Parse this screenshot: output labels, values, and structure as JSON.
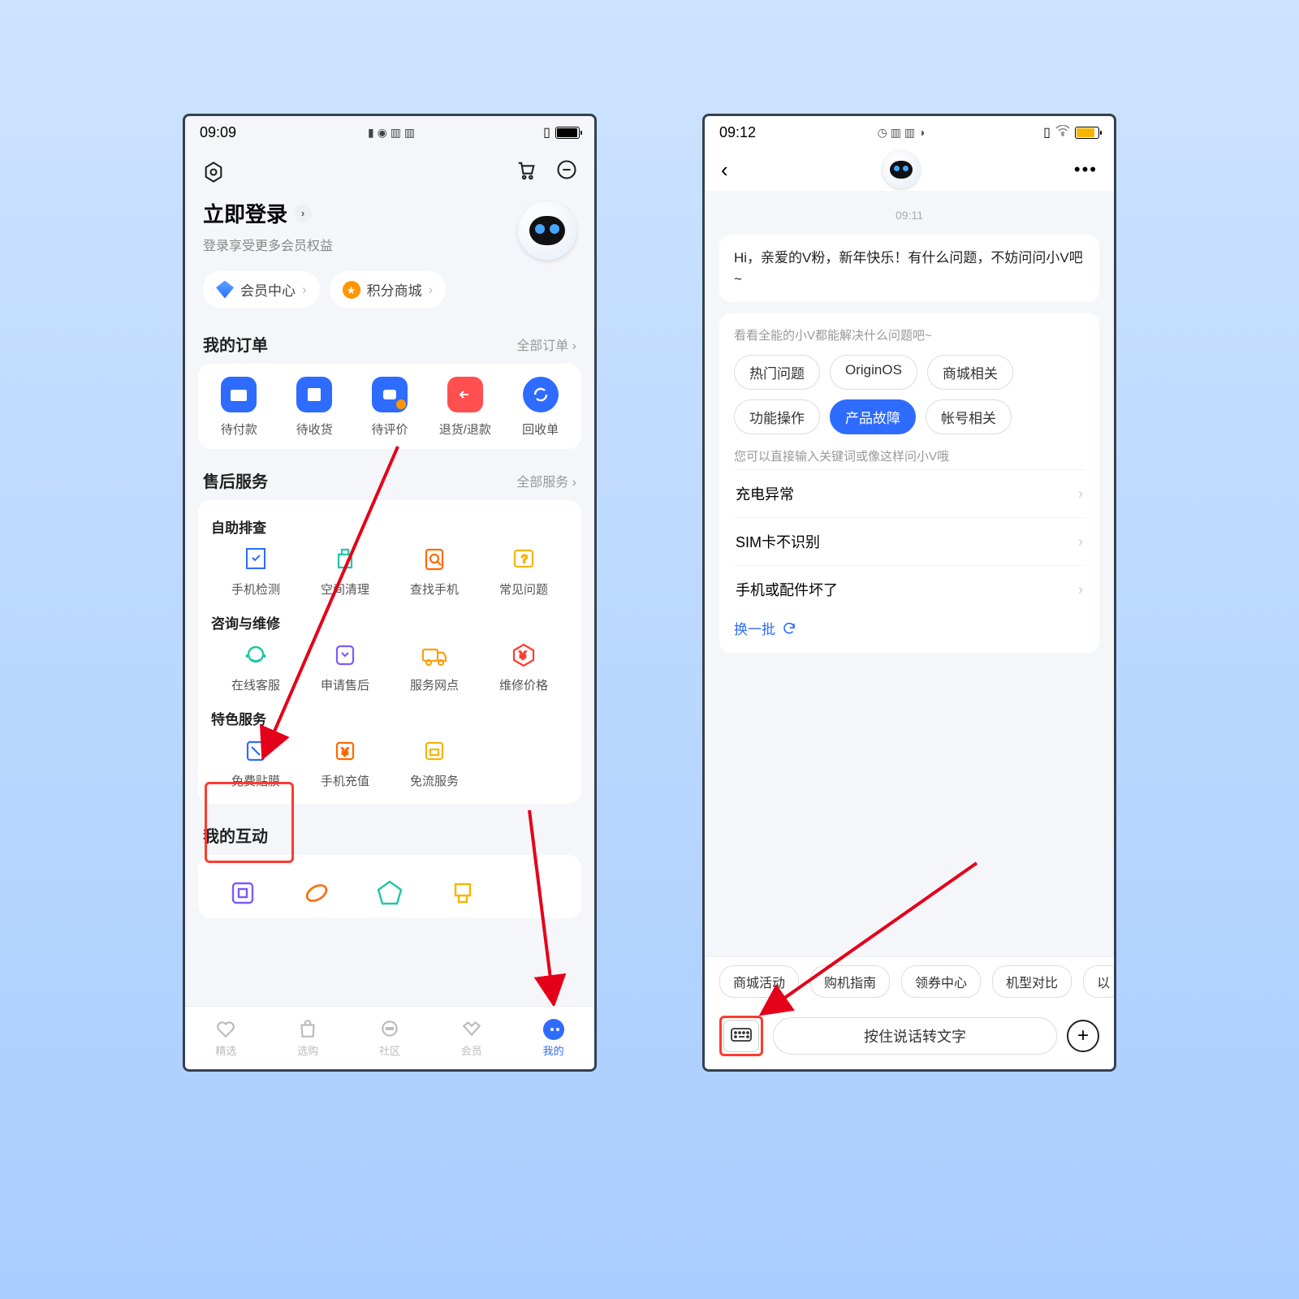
{
  "left": {
    "status_time": "09:09",
    "login_title": "立即登录",
    "login_sub": "登录享受更多会员权益",
    "pill1": "会员中心",
    "pill2": "积分商城",
    "orders_title": "我的订单",
    "orders_link": "全部订单",
    "order_items": [
      "待付款",
      "待收货",
      "待评价",
      "退货/退款",
      "回收单"
    ],
    "service_title": "售后服务",
    "service_link": "全部服务",
    "sc_self": "自助排查",
    "self_items": [
      "手机检测",
      "空间清理",
      "查找手机",
      "常见问题"
    ],
    "sc_consult": "咨询与维修",
    "consult_items": [
      "在线客服",
      "申请售后",
      "服务网点",
      "维修价格"
    ],
    "sc_special": "特色服务",
    "special_items": [
      "免费贴膜",
      "手机充值",
      "免流服务"
    ],
    "interact_title": "我的互动",
    "tabs": [
      "精选",
      "选购",
      "社区",
      "会员",
      "我的"
    ]
  },
  "right": {
    "status_time": "09:12",
    "chat_ts": "09:11",
    "bubble_text": "Hi，亲爱的V粉，新年快乐！有什么问题，不妨问问小V吧~",
    "faq_hint1": "看看全能的小V都能解决什么问题吧~",
    "chips": [
      "热门问题",
      "OriginOS",
      "商城相关",
      "功能操作",
      "产品故障",
      "帐号相关"
    ],
    "chip_active_index": 4,
    "faq_hint2": "您可以直接输入关键词或像这样问小V哦",
    "faq_rows": [
      "充电异常",
      "SIM卡不识别",
      "手机或配件坏了"
    ],
    "refresh": "换一批",
    "quick_chips": [
      "商城活动",
      "购机指南",
      "领券中心",
      "机型对比",
      "以"
    ],
    "voice_placeholder": "按住说话转文字"
  }
}
